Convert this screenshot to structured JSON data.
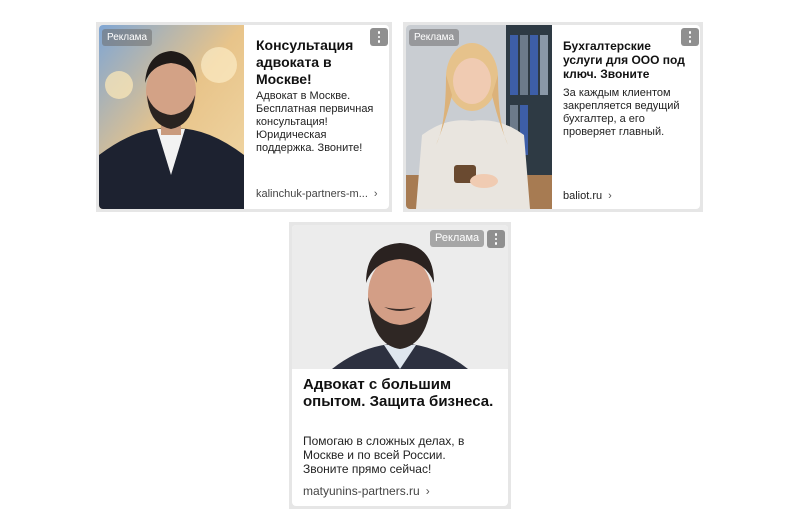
{
  "ad_label": "Реклама",
  "ads": [
    {
      "title": "Консультация адвоката в Москве!",
      "description": "Адвокат в Москве. Бесплатная первичная консультация! Юридическая поддержка. Звоните!",
      "domain": "kalinchuk-partners-m...",
      "chevron": "›",
      "menu_icon": "vertical-dots-icon"
    },
    {
      "title": "Бухгалтерские услуги для ООО под ключ. Звоните",
      "description": "За каждым клиентом закрепляется ведущий бухгалтер, а его проверяет главный.",
      "domain": "baliot.ru",
      "chevron": "›",
      "menu_icon": "vertical-dots-icon"
    },
    {
      "title": "Адвокат с большим опытом. Защита бизнеса.",
      "description": "Помогаю в сложных делах, в Москве и по всей России. Звоните прямо сейчас!",
      "domain": "matyunins-partners.ru",
      "chevron": "›",
      "menu_icon": "vertical-dots-icon"
    }
  ]
}
